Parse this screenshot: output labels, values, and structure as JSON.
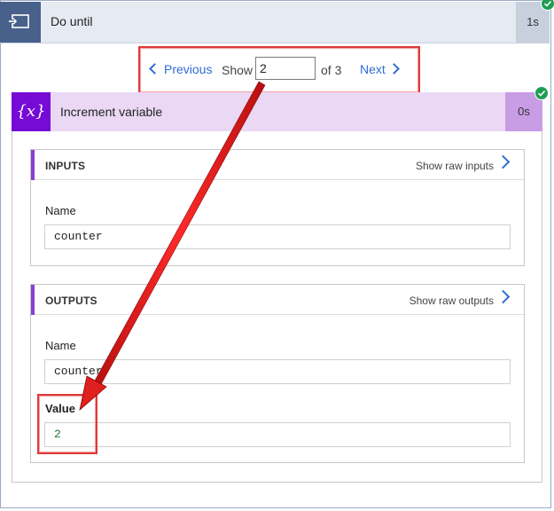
{
  "do_until": {
    "title": "Do until",
    "duration": "1s",
    "icon": "loop-icon"
  },
  "pager": {
    "previous_label": "Previous",
    "show_label": "Show",
    "current_page": "2",
    "of_label": "of 3",
    "next_label": "Next"
  },
  "increment": {
    "icon_text": "{x}",
    "title": "Increment variable",
    "duration": "0s"
  },
  "inputs": {
    "title": "INPUTS",
    "raw_link": "Show raw inputs",
    "name_label": "Name",
    "name_value": "counter"
  },
  "outputs": {
    "title": "OUTPUTS",
    "raw_link": "Show raw outputs",
    "name_label": "Name",
    "name_value": "counter",
    "value_label": "Value",
    "value_value": "2"
  },
  "colors": {
    "success": "#1e9d53",
    "annotation": "#e03a3a",
    "accent_purple": "#770bd6",
    "link_blue": "#2f6dd4"
  }
}
